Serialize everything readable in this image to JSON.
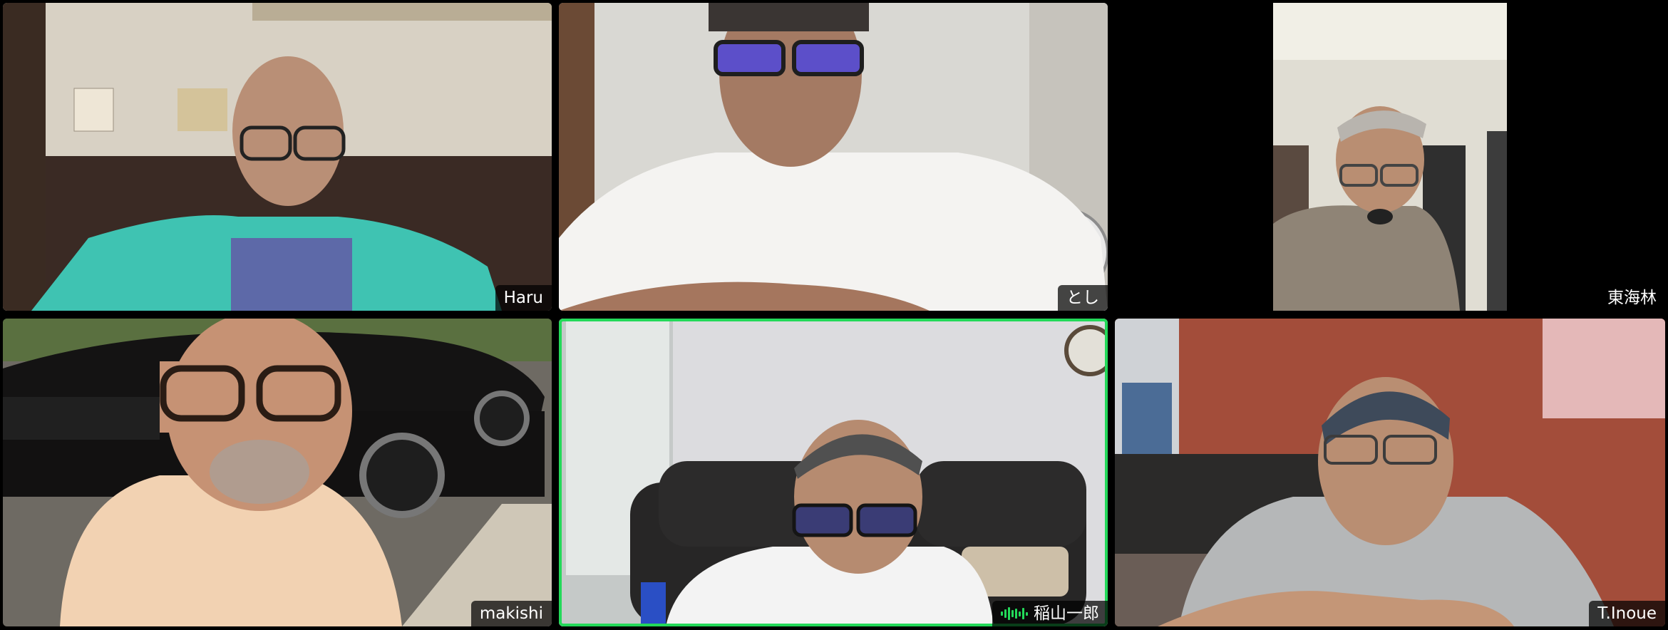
{
  "gallery": {
    "participants": [
      {
        "name": "Haru",
        "active_speaker": false
      },
      {
        "name": "とし",
        "active_speaker": false
      },
      {
        "name": "東海林",
        "active_speaker": false
      },
      {
        "name": "makishi",
        "active_speaker": false
      },
      {
        "name": "稲山一郎",
        "active_speaker": true
      },
      {
        "name": "T.Inoue",
        "active_speaker": false
      }
    ],
    "active_speaker_color": "#23d959",
    "active_speaker_icon": "audio-level-icon"
  }
}
